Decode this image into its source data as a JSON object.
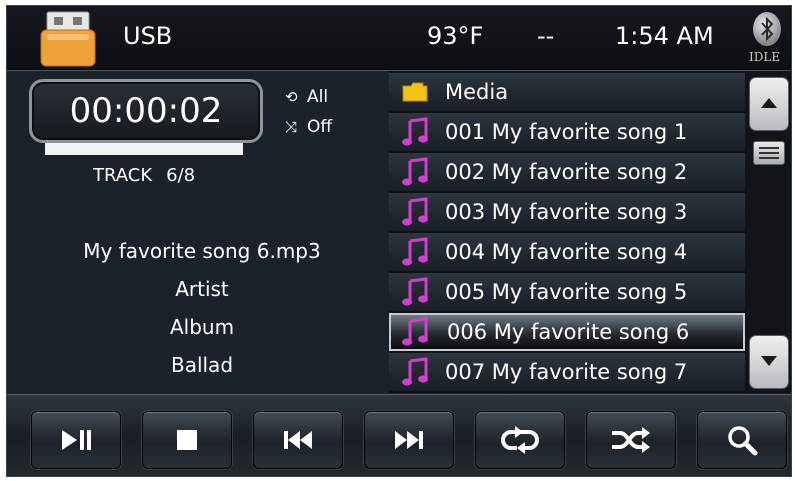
{
  "header": {
    "source_label": "USB",
    "temperature": "93°F",
    "placeholder": "--",
    "time": "1:54 AM",
    "bluetooth_status": "IDLE"
  },
  "player": {
    "elapsed": "00:00:02",
    "progress_fraction": 0.0,
    "track_label": "TRACK",
    "track_value": "6/8",
    "repeat_mode": "All",
    "shuffle_mode": "Off",
    "file_name": "My favorite song 6.mp3",
    "artist": "Artist",
    "album": "Album",
    "genre": "Ballad"
  },
  "list": {
    "items": [
      {
        "label": "Media",
        "icon": "folder-icon"
      },
      {
        "label": "001 My favorite song 1",
        "icon": "music-note-icon"
      },
      {
        "label": "002 My favorite song 2",
        "icon": "music-note-icon"
      },
      {
        "label": "003 My favorite song 3",
        "icon": "music-note-icon"
      },
      {
        "label": "004 My favorite song 4",
        "icon": "music-note-icon"
      },
      {
        "label": "005 My favorite song 5",
        "icon": "music-note-icon"
      },
      {
        "label": "006 My favorite song 6",
        "icon": "music-note-icon",
        "selected": true
      },
      {
        "label": "007 My favorite song 7",
        "icon": "music-note-icon"
      }
    ]
  },
  "controls": {
    "buttons": [
      "play-pause-icon",
      "stop-icon",
      "previous-track-icon",
      "next-track-icon",
      "repeat-icon",
      "shuffle-icon",
      "search-icon"
    ]
  },
  "colors": {
    "background": "#1b2128",
    "note_icon": "#d13fd0",
    "folder_icon": "#f2c21a",
    "text": "#ffffff"
  }
}
